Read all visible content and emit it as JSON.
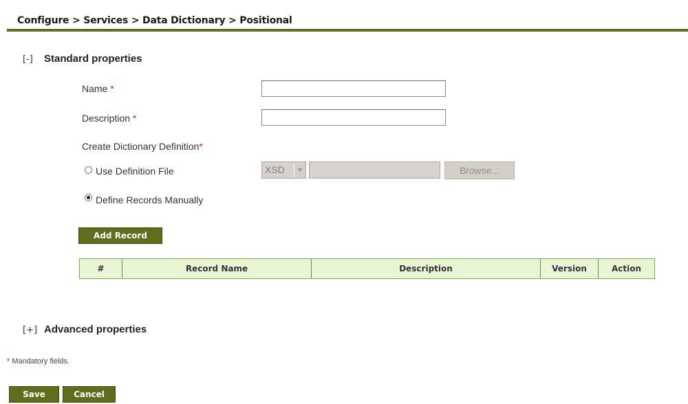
{
  "breadcrumb": "Configure > Services > Data Dictionary > Positional",
  "standard": {
    "toggle": "[-]",
    "title": "Standard properties"
  },
  "fields": {
    "name_label": "Name",
    "description_label": "Description",
    "required_mark": "*",
    "name_value": "",
    "description_value": ""
  },
  "definition": {
    "title": "Create Dictionary Definition",
    "use_file_label": "Use Definition File",
    "manual_label": "Define Records Manually",
    "selected": "manual",
    "file_type": "XSD",
    "browse_label": "Browse..."
  },
  "add_record_label": "Add Record",
  "table": {
    "headers": [
      "#",
      "Record Name",
      "Description",
      "Version",
      "Action"
    ],
    "rows": []
  },
  "advanced": {
    "toggle": "[+]",
    "title": "Advanced properties"
  },
  "footnote": {
    "mark": "*",
    "text": " Mandatory fields."
  },
  "actions": {
    "save": "Save",
    "cancel": "Cancel"
  },
  "colors": {
    "accent": "#5f6e1c",
    "table_border": "#6ab54a",
    "table_header_bg": "#eaf5d6",
    "required": "#dd2222"
  }
}
